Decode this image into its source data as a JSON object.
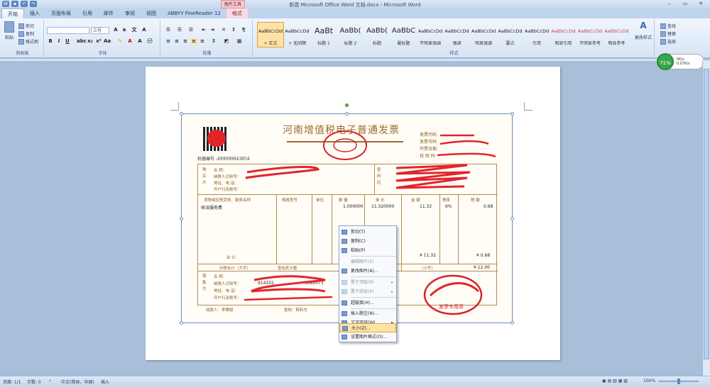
{
  "window": {
    "title": "新建 Microsoft Office Word 文档.docx - Microsoft Word",
    "context_tool": "图片工具"
  },
  "tabs": [
    "开始",
    "插入",
    "页面布局",
    "引用",
    "邮件",
    "审阅",
    "视图",
    "ABBYY FineReader 12",
    "格式"
  ],
  "ribbon": {
    "clipboard": {
      "paste": "粘贴",
      "cut": "剪切",
      "copy": "复制",
      "painter": "格式刷",
      "label": "剪贴板"
    },
    "font": {
      "size": "三号",
      "label": "字体"
    },
    "paragraph": {
      "label": "段落"
    },
    "styles": {
      "label": "样式",
      "items": [
        {
          "preview": "AaBbCcDd",
          "name": "+ 正文"
        },
        {
          "preview": "AaBbCcDd",
          "name": "+ 无间隔"
        },
        {
          "preview": "AaBt",
          "name": "标题 1"
        },
        {
          "preview": "AaBb(",
          "name": "标题 2"
        },
        {
          "preview": "AaBb(",
          "name": "标题"
        },
        {
          "preview": "AaBbC",
          "name": "副标题"
        },
        {
          "preview": "AaBbCcDd",
          "name": "不明显强调"
        },
        {
          "preview": "AaBbCcDd",
          "name": "强调"
        },
        {
          "preview": "AaBbCcDd",
          "name": "明显强调"
        },
        {
          "preview": "AaBbCcDd",
          "name": "要点"
        },
        {
          "preview": "AaBbCcDd",
          "name": "引用"
        },
        {
          "preview": "AaBbCcDd",
          "name": "明显引用"
        },
        {
          "preview": "AaBbCcDd",
          "name": "不明显参考"
        },
        {
          "preview": "AaBbCcDd",
          "name": "明显参考"
        }
      ],
      "change": "更改样式"
    },
    "editing": {
      "find": "查找",
      "replace": "替换",
      "select": "选择"
    }
  },
  "net_gadget": {
    "percent": "71%",
    "up": "0K/s",
    "down": "0.07K/s"
  },
  "invoice": {
    "title": "河南增值税电子普通发票",
    "machine_no": "机器编号 :499099843854",
    "meta": [
      "发票代码",
      "发票号码",
      "开票日期",
      "校 验 码"
    ],
    "buyer": [
      "名 称：",
      "纳税人识别号：",
      "地址、电 话：",
      "开户行及账号："
    ],
    "password_label": "密 码 区",
    "headers": [
      "货物或应税劳务、服务名称",
      "规格型号",
      "单位",
      "数 量",
      "单 价",
      "金 额",
      "税率",
      "税 额"
    ],
    "item": {
      "name": "收派服务费",
      "qty": "1.000000",
      "price": "11.320000",
      "amount": "11.32",
      "rate": "6%",
      "tax": "0.68"
    },
    "total_label": "合 计",
    "total_amount": "¥ 11.32",
    "total_tax": "¥ 0.68",
    "in_words_label": "价税合计（大写）",
    "in_words": "壹拾贰元整",
    "small_label": "（小写）",
    "small_value": "¥ 12.00",
    "seller": [
      "名 称：",
      "纳税人识别号：",
      "地址、电 话：",
      "开户行及账号："
    ],
    "seller_taxid": "914101",
    "seller_taxid_tail": "6080073",
    "payee": "收款人：李赛斌",
    "reviewer": "复核：韩利方",
    "seal_text": "发票专用章"
  },
  "context_menu": [
    {
      "label": "剪切(T)",
      "disabled": false
    },
    {
      "label": "复制(C)",
      "disabled": false
    },
    {
      "label": "粘贴(P)",
      "disabled": false
    },
    {
      "label": "编辑图片(E)",
      "disabled": true
    },
    {
      "label": "更改图片(A)...",
      "disabled": false
    },
    {
      "label": "置于顶层(R)",
      "disabled": true
    },
    {
      "label": "置于底层(K)",
      "disabled": true
    },
    {
      "label": "超链接(H)...",
      "disabled": false
    },
    {
      "label": "插入题注(N)...",
      "disabled": false
    },
    {
      "label": "文字环绕(W)",
      "disabled": false
    },
    {
      "label": "大小(Z)...",
      "disabled": false
    },
    {
      "label": "设置图片格式(O)...",
      "disabled": false
    }
  ],
  "status": {
    "page": "页面: 1/1",
    "words": "字数: 0",
    "lang": "中文(简体，中国)",
    "mode": "插入",
    "zoom": "100%"
  }
}
